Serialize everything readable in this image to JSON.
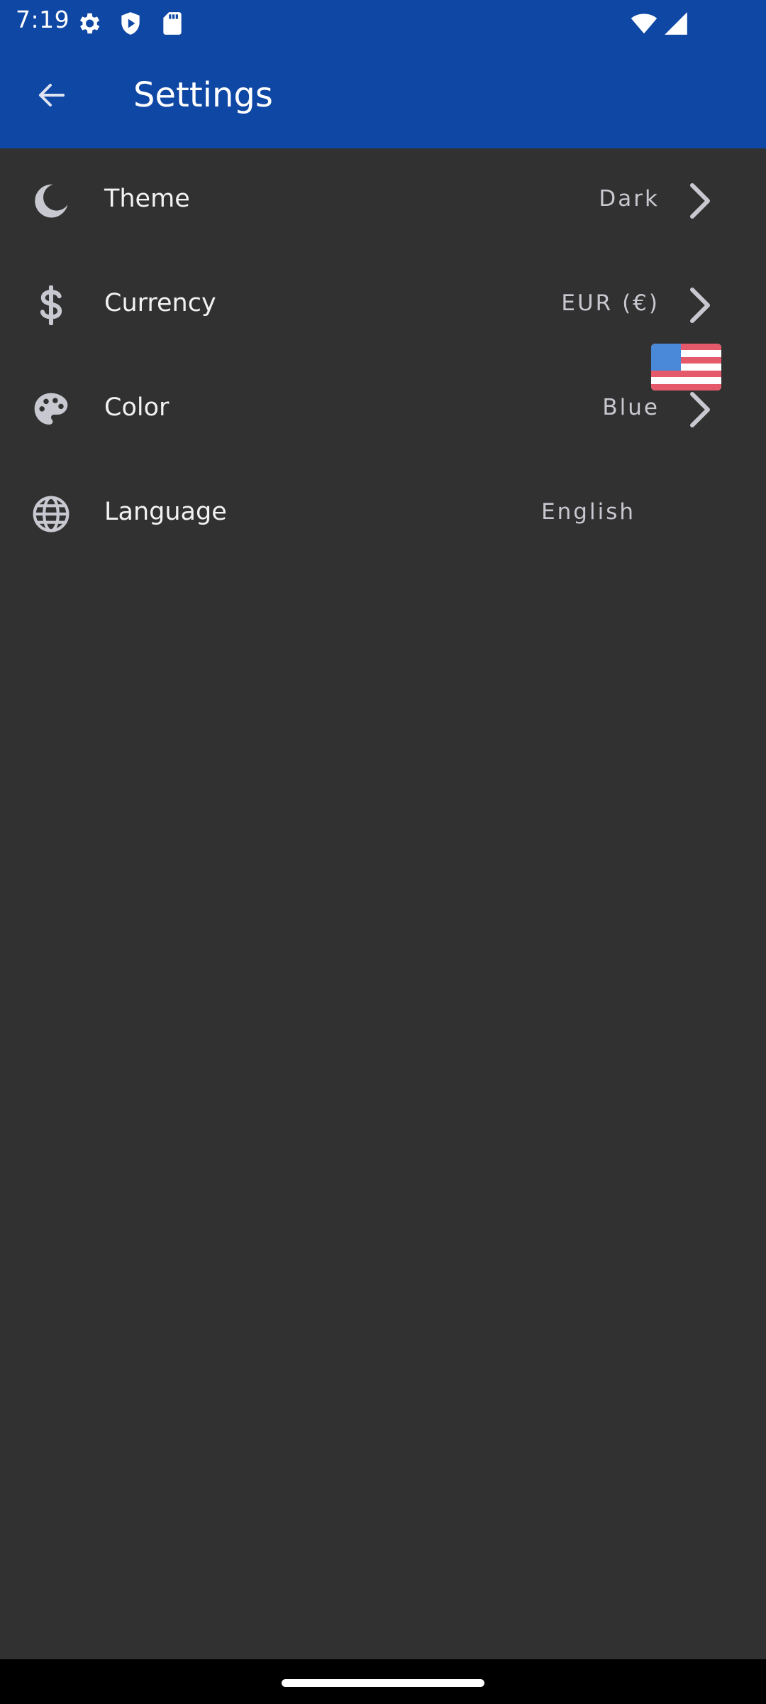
{
  "status_bar": {
    "time": "7:19",
    "icons": [
      "settings-gear-icon",
      "shield-icon",
      "sd-card-icon",
      "wifi-icon",
      "signal-icon"
    ]
  },
  "toolbar": {
    "title": "Settings",
    "back_icon": "arrow-left-icon"
  },
  "settings": [
    {
      "icon": "moon-icon",
      "label": "Theme",
      "value": "Dark"
    },
    {
      "icon": "dollar-icon",
      "label": "Currency",
      "value": "EUR (€)"
    },
    {
      "icon": "palette-icon",
      "label": "Color",
      "value": "Blue"
    },
    {
      "icon": "globe-icon",
      "label": "Language",
      "value": "English"
    }
  ],
  "colors": {
    "header": "#0f47a4",
    "background": "#313131",
    "icon": "#c8c8d0",
    "text": "#f2f2f2"
  }
}
